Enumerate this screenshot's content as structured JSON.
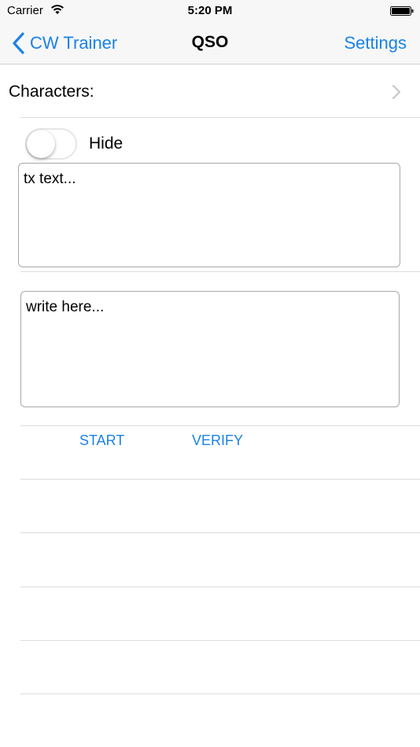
{
  "status_bar": {
    "carrier": "Carrier",
    "time": "5:20 PM"
  },
  "nav": {
    "back_label": "CW Trainer",
    "title": "QSO",
    "settings_label": "Settings"
  },
  "characters": {
    "label": "Characters:"
  },
  "hide_toggle": {
    "label": "Hide",
    "on": false
  },
  "tx_field": {
    "text": "tx text..."
  },
  "write_field": {
    "text": "write here..."
  },
  "buttons": {
    "start": "START",
    "verify": "VERIFY"
  },
  "colors": {
    "accent": "#1a82e7",
    "bar_background": "#f7f7f7",
    "separator": "#dcdcdf"
  }
}
